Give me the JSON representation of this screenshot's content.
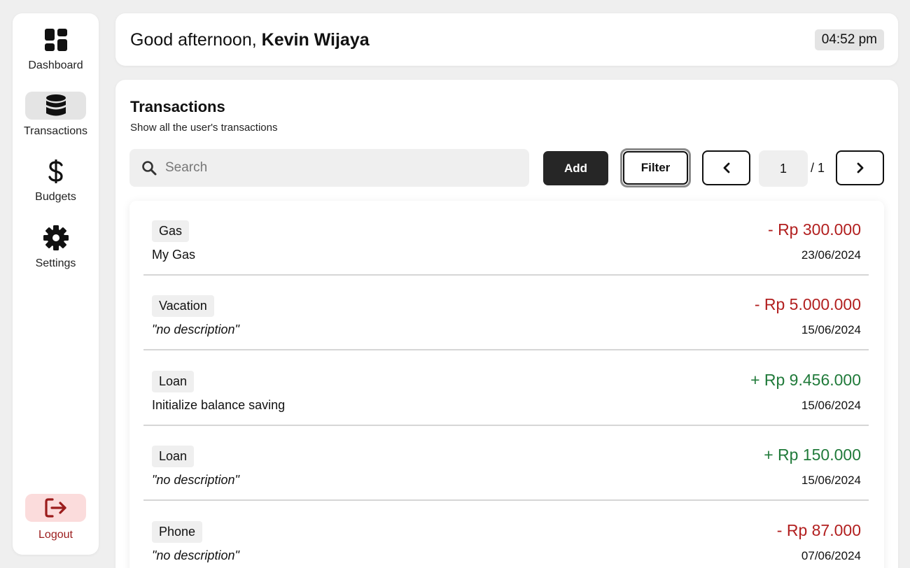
{
  "sidebar": {
    "items": [
      {
        "label": "Dashboard",
        "icon": "dashboard-icon"
      },
      {
        "label": "Transactions",
        "icon": "database-icon",
        "active": true
      },
      {
        "label": "Budgets",
        "icon": "dollar-icon"
      },
      {
        "label": "Settings",
        "icon": "gear-icon"
      }
    ],
    "logout_label": "Logout"
  },
  "header": {
    "greeting_prefix": "Good afternoon, ",
    "user_name": "Kevin Wijaya",
    "time": "04:52 pm"
  },
  "main": {
    "title": "Transactions",
    "subtitle": "Show all the user's transactions",
    "search_placeholder": "Search",
    "add_label": "Add",
    "filter_label": "Filter",
    "page_current": "1",
    "page_total": "/ 1"
  },
  "colors": {
    "expense": "#b21f1f",
    "income": "#207a3a",
    "logout_bg": "#fbdcdc"
  },
  "transactions": [
    {
      "category": "Gas",
      "description": "My Gas",
      "amount": "- Rp 300.000",
      "date": "23/06/2024",
      "type": "expense"
    },
    {
      "category": "Vacation",
      "description": "\"no description\"",
      "amount": "- Rp 5.000.000",
      "date": "15/06/2024",
      "type": "expense"
    },
    {
      "category": "Loan",
      "description": "Initialize balance saving",
      "amount": "+ Rp 9.456.000",
      "date": "15/06/2024",
      "type": "income"
    },
    {
      "category": "Loan",
      "description": "\"no description\"",
      "amount": "+ Rp 150.000",
      "date": "15/06/2024",
      "type": "income"
    },
    {
      "category": "Phone",
      "description": "\"no description\"",
      "amount": "- Rp 87.000",
      "date": "07/06/2024",
      "type": "expense"
    }
  ]
}
